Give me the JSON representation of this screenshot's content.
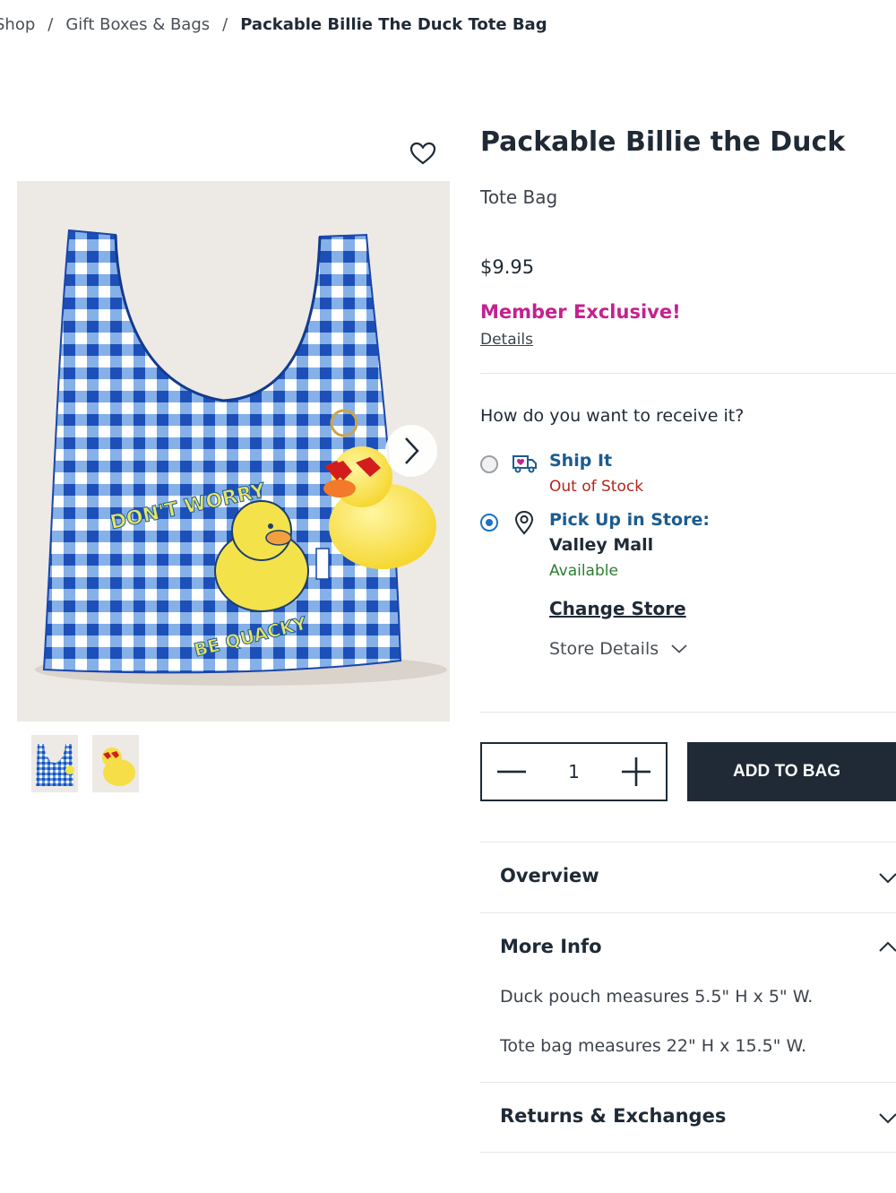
{
  "breadcrumb": {
    "items": [
      "Shop",
      "Gift Boxes & Bags",
      "Packable Billie The Duck Tote Bag"
    ],
    "separator": "/"
  },
  "gallery": {
    "main_icon": "product-photo",
    "thumbnails": [
      "thumbnail-tote",
      "thumbnail-duck-pouch"
    ],
    "bag_print_top": "DON'T WORRY",
    "bag_print_bottom": "BE QUACKY"
  },
  "product": {
    "title": "Packable Billie the Duck",
    "subtitle": "Tote Bag",
    "price": "$9.95",
    "member_badge": "Member Exclusive!",
    "details_link": "Details"
  },
  "fulfillment": {
    "question": "How do you want to receive it?",
    "ship": {
      "label": "Ship It",
      "status": "Out of Stock",
      "selected": false
    },
    "pickup": {
      "label": "Pick Up in Store:",
      "store": "Valley Mall",
      "status": "Available",
      "selected": true,
      "change_store": "Change Store",
      "store_details": "Store Details"
    }
  },
  "purchase": {
    "quantity": "1",
    "add_to_bag": "ADD TO BAG"
  },
  "accordion": {
    "overview": "Overview",
    "more_info": "More Info",
    "more_info_lines": [
      "Duck pouch measures 5.5\" H x 5\" W.",
      "Tote bag measures 22\" H x 15.5\" W."
    ],
    "returns": "Returns & Exchanges"
  },
  "colors": {
    "member": "#c4218f",
    "link_blue": "#1c5c8f",
    "out_of_stock": "#b3261e",
    "available": "#2e7d32",
    "button_dark": "#1f2a36"
  }
}
